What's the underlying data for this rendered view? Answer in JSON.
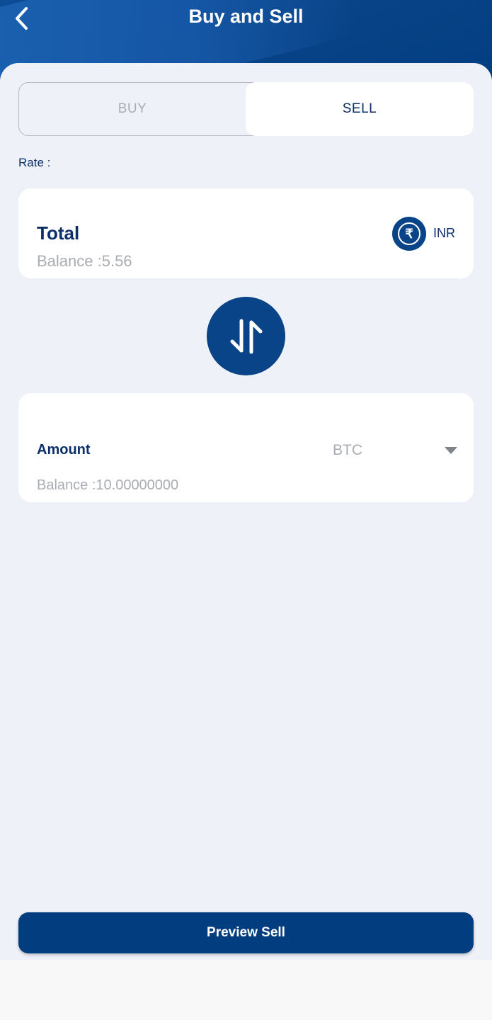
{
  "header": {
    "title": "Buy and Sell"
  },
  "toggle": {
    "buy_label": "BUY",
    "sell_label": "SELL",
    "selected": "SELL"
  },
  "rate": {
    "label": "Rate :"
  },
  "total_card": {
    "label": "Total",
    "balance": "Balance :5.56",
    "currency_symbol": "₹",
    "currency_code": "INR",
    "icon": "rupee-icon"
  },
  "swap": {
    "icon": "swap-arrows-icon"
  },
  "amount_card": {
    "label": "Amount",
    "selected_asset": "BTC",
    "balance": "Balance :10.00000000"
  },
  "actions": {
    "preview_label": "Preview Sell"
  },
  "colors": {
    "primary": "#0a4488",
    "text_dark": "#0b2f6b",
    "text_muted": "#a9adb3",
    "background": "#eef2f8"
  }
}
